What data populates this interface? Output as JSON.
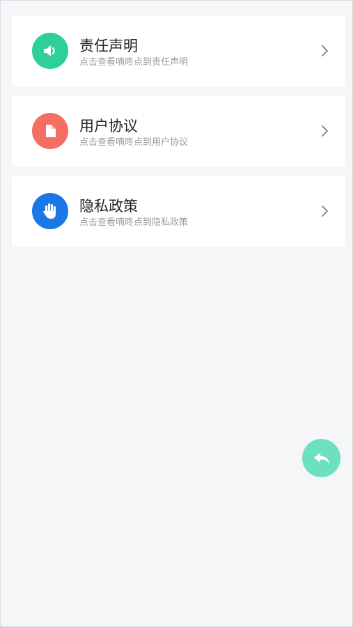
{
  "items": [
    {
      "title": "责任声明",
      "subtitle": "点击查看嘀咚点到责任声明",
      "icon": "speaker-icon",
      "icon_color": "#2fcf99"
    },
    {
      "title": "用户协议",
      "subtitle": "点击查看嘀咚点到用户协议",
      "icon": "document-icon",
      "icon_color": "#f56e64"
    },
    {
      "title": "隐私政策",
      "subtitle": "点击查看嘀咚点到隐私政策",
      "icon": "hand-icon",
      "icon_color": "#1a77e6"
    }
  ],
  "fab": {
    "icon": "reply-icon",
    "color": "#6de0bd"
  },
  "colors": {
    "background": "#f5f6f8",
    "card": "#ffffff",
    "title_text": "#222428",
    "subtitle_text": "#9a9ca2",
    "chevron": "#8a8d92"
  }
}
